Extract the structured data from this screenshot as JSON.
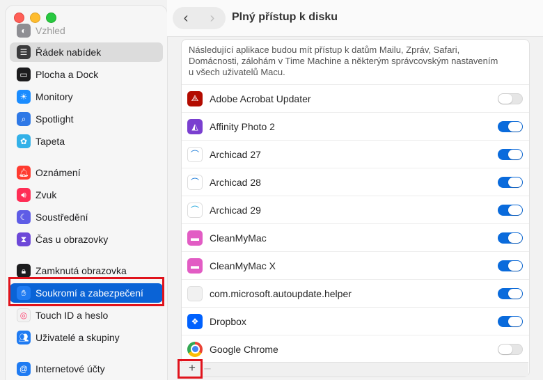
{
  "header": {
    "title": "Plný přístup k disku",
    "back_icon": "chevron-left-icon",
    "forward_icon": "chevron-right-icon"
  },
  "sidebar": {
    "items": [
      {
        "label": "Vzhled",
        "icon": "appearance-icon",
        "color": "#8e8e93",
        "state": "faded"
      },
      {
        "label": "Řádek nabídek",
        "icon": "menu-bar-icon",
        "color": "#3a3a3c",
        "state": "hover"
      },
      {
        "label": "Plocha a Dock",
        "icon": "desktop-dock-icon",
        "color": "#1c1c1e",
        "state": ""
      },
      {
        "label": "Monitory",
        "icon": "display-icon",
        "color": "#1a8cff",
        "state": ""
      },
      {
        "label": "Spotlight",
        "icon": "spotlight-icon",
        "color": "#2e78e6",
        "state": ""
      },
      {
        "label": "Tapeta",
        "icon": "wallpaper-icon",
        "color": "#33b1e8",
        "state": ""
      },
      {
        "label": "Oznámení",
        "icon": "notifications-icon",
        "color": "#ff3b30",
        "state": ""
      },
      {
        "label": "Zvuk",
        "icon": "sound-icon",
        "color": "#ff2d55",
        "state": ""
      },
      {
        "label": "Soustředění",
        "icon": "focus-icon",
        "color": "#5e5ce6",
        "state": ""
      },
      {
        "label": "Čas u obrazovky",
        "icon": "screen-time-icon",
        "color": "#6d48d8",
        "state": ""
      },
      {
        "label": "Zamknutá obrazovka",
        "icon": "lock-screen-icon",
        "color": "#1c1c1e",
        "state": ""
      },
      {
        "label": "Soukromí a zabezpečení",
        "icon": "privacy-hand-icon",
        "color": "#1f7bf2",
        "state": "selected"
      },
      {
        "label": "Touch ID a heslo",
        "icon": "touch-id-icon",
        "color": "#f2f2f2",
        "state": ""
      },
      {
        "label": "Uživatelé a skupiny",
        "icon": "users-groups-icon",
        "color": "#1f7bf2",
        "state": ""
      },
      {
        "label": "Internetové účty",
        "icon": "internet-accounts-icon",
        "color": "#1f7bf2",
        "state": ""
      }
    ]
  },
  "content": {
    "description_lines": [
      "Následující aplikace budou mít přístup k datům Mailu, Zpráv, Safari,",
      "Domácnosti, zálohám v Time Machine a některým správcovským nastavením",
      "u všech uživatelů Macu."
    ],
    "apps": [
      {
        "name": "Adobe Acrobat Updater",
        "icon": "acrobat-icon",
        "color": "#b30b00",
        "enabled": false
      },
      {
        "name": "Affinity Photo 2",
        "icon": "affinity-photo-icon",
        "color": "#7a3fd0",
        "enabled": true
      },
      {
        "name": "Archicad 27",
        "icon": "archicad-icon",
        "color": "#ffffff",
        "enabled": true
      },
      {
        "name": "Archicad 28",
        "icon": "archicad-icon",
        "color": "#ffffff",
        "enabled": true
      },
      {
        "name": "Archicad 29",
        "icon": "archicad-icon",
        "color": "#ffffff",
        "enabled": true
      },
      {
        "name": "CleanMyMac",
        "icon": "cleanmymac-icon",
        "color": "#e25cc4",
        "enabled": true
      },
      {
        "name": "CleanMyMac X",
        "icon": "cleanmymac-x-icon",
        "color": "#e25cc4",
        "enabled": true
      },
      {
        "name": "com.microsoft.autoupdate.helper",
        "icon": "generic-app-icon",
        "color": "#f1f1f1",
        "enabled": true
      },
      {
        "name": "Dropbox",
        "icon": "dropbox-icon",
        "color": "#0061fe",
        "enabled": true
      },
      {
        "name": "Google Chrome",
        "icon": "chrome-icon",
        "color": "#ffffff",
        "enabled": false
      }
    ],
    "add_label": "+",
    "remove_label": "–"
  },
  "colors": {
    "accent": "#0a6bdc",
    "highlight_outline": "#e0131c"
  }
}
